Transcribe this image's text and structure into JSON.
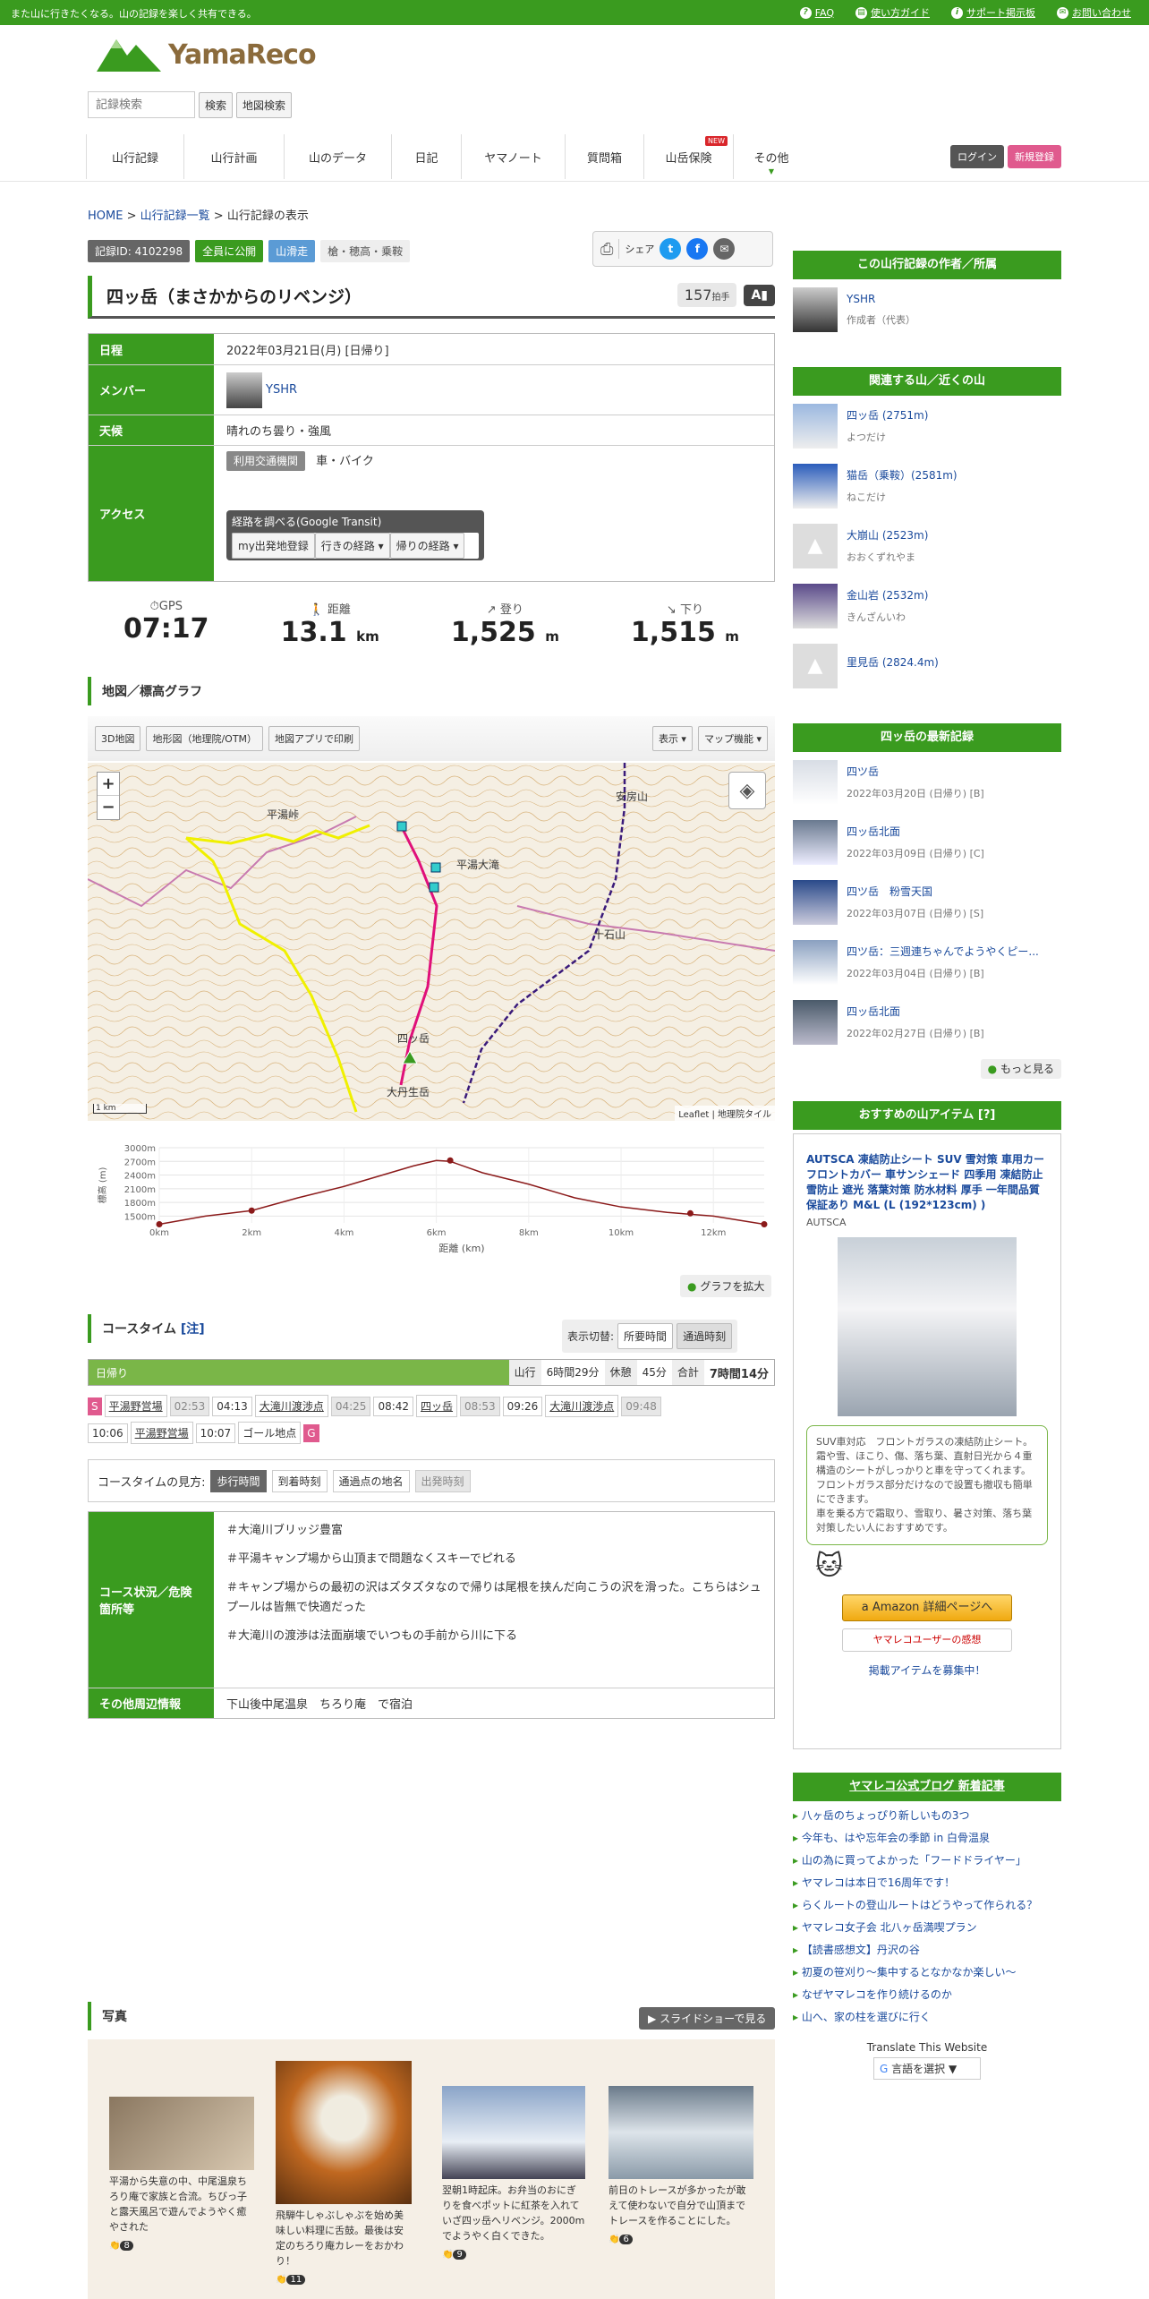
{
  "topbar": {
    "tagline": "また山に行きたくなる。山の記録を楽しく共有できる。",
    "links": [
      "FAQ",
      "使い方ガイド",
      "サポート掲示板",
      "お問い合わせ"
    ]
  },
  "logo": {
    "text": "YamaReco"
  },
  "search": {
    "placeholder": "記録検索",
    "button": "検索",
    "map_button": "地図検索"
  },
  "nav": {
    "items": [
      "山行記録",
      "山行計画",
      "山のデータ",
      "日記",
      "ヤマノート",
      "質問箱",
      "山岳保険",
      "その他"
    ],
    "new_badge": "NEW",
    "login": "ログイン",
    "signup": "新規登録"
  },
  "breadcrumb": {
    "home": "HOME",
    "list": "山行記録一覧",
    "current": "山行記録の表示",
    "sep": ">"
  },
  "badges": [
    "記録ID: 4102298",
    "全員に公開",
    "山滑走",
    "槍・穂高・乗鞍"
  ],
  "share": {
    "label": "シェア"
  },
  "title": "四ッ岳（まさかからのリベンジ）",
  "handclap": {
    "count": "157",
    "unit": "拍手"
  },
  "info": {
    "date_label": "日程",
    "date": "2022年03月21日(月) [日帰り]",
    "member_label": "メンバー",
    "member": "YSHR",
    "weather_label": "天候",
    "weather": "晴れのち曇り・強風",
    "access_label": "アクセス",
    "access_tag": "利用交通機関",
    "access": "車・バイク",
    "route_title": "経路を調べる(Google Transit)",
    "route_btns": [
      "my出発地登録",
      "行きの経路 ▾",
      "帰りの経路 ▾"
    ]
  },
  "stats": [
    {
      "label": "GPS",
      "value": "07:17",
      "unit": ""
    },
    {
      "label": "距離",
      "value": "13.1",
      "unit": "km"
    },
    {
      "label": "登り",
      "value": "1,525",
      "unit": "m"
    },
    {
      "label": "下り",
      "value": "1,515",
      "unit": "m"
    }
  ],
  "map_section": {
    "title": "地図／標高グラフ",
    "buttons": [
      "3D地図",
      "地形図（地理院/OTM）",
      "地図アプリで印刷"
    ],
    "right": [
      "表示 ▾",
      "マップ機能 ▾"
    ],
    "labels": [
      "平湯峠",
      "平湯大滝",
      "安房山",
      "十石山",
      "四ッ岳",
      "大丹生岳"
    ],
    "attr": "Leaflet | 地理院タイル",
    "scale": "1 km"
  },
  "chart_data": {
    "type": "line",
    "ylabel": "標高 (m)",
    "xlabel": "距離 (km)",
    "yticks": [
      "3000m",
      "2700m",
      "2400m",
      "2100m",
      "1800m",
      "1500m"
    ],
    "xticks": [
      "0km",
      "2km",
      "4km",
      "6km",
      "8km",
      "10km",
      "12km"
    ],
    "ylim": [
      1350,
      3000
    ],
    "xlim": [
      0,
      13.1
    ],
    "x": [
      0,
      1,
      2,
      3,
      4,
      5,
      5.5,
      6,
      6.3,
      7,
      8,
      9,
      10,
      11,
      12,
      13.1
    ],
    "y": [
      1320,
      1500,
      1620,
      1900,
      2150,
      2450,
      2600,
      2720,
      2700,
      2450,
      2200,
      1900,
      1700,
      1580,
      1500,
      1320
    ],
    "markers": [
      [
        0,
        1320
      ],
      [
        2,
        1620
      ],
      [
        6.3,
        2720
      ],
      [
        11.5,
        1560
      ],
      [
        13.1,
        1320
      ]
    ]
  },
  "expand": "グラフを拡大",
  "coursetime": {
    "title": "コースタイム",
    "note": "[注]",
    "toggle_label": "表示切替:",
    "toggle": [
      "所要時間",
      "通過時刻"
    ],
    "day": "日帰り",
    "move_label": "山行",
    "move": "6時間29分",
    "rest_label": "休憩",
    "rest": "45分",
    "total_label": "合計",
    "total": "7時間14分",
    "row1": [
      "S",
      "平湯野営場",
      "02:53",
      "04:13",
      "大滝川渡渉点",
      "04:25",
      "08:42",
      "四ッ岳",
      "08:53",
      "09:26",
      "大滝川渡渉点",
      "09:48"
    ],
    "row2": [
      "10:06",
      "平湯野営場",
      "10:07",
      "ゴール地点",
      "G"
    ],
    "howto_label": "コースタイムの見方:",
    "howto": [
      "歩行時間",
      "到着時刻",
      "通過点の地名",
      "出発時刻"
    ]
  },
  "course": {
    "cond_label": "コース状況／危険箇所等",
    "lines": [
      "＃大滝川ブリッジ豊富",
      "＃平湯キャンプ場から山頂まで問題なくスキーでピれる",
      "＃キャンプ場からの最初の沢はズタズタなので帰りは尾根を挟んだ向こうの沢を滑った。こちらはシュプールは皆無で快適だった",
      "＃大滝川の渡渉は法面崩壊でいつもの手前から川に下る"
    ],
    "other_label": "その他周辺情報",
    "other": "下山後中尾温泉　ちろり庵　で宿泊"
  },
  "photos": {
    "title": "写真",
    "slideshow": "スライドショーで見る",
    "items": [
      {
        "caption": "平湯から失意の中、中尾温泉ちろり庵で家族と合流。ちびっ子と露天風呂で遊んでようやく癒やされた",
        "likes": "8"
      },
      {
        "caption": "飛騨牛しゃぶしゃぶを始め美味しい料理に舌鼓。最後は安定のちろり庵カレーをおかわり！",
        "likes": "11"
      },
      {
        "caption": "翌朝1時起床。お弁当のおにぎりを食べポットに紅茶を入れていざ四ッ岳へリベンジ。2000mでようやく白くできた。",
        "likes": "9"
      },
      {
        "caption": "前日のトレースが多かったが敢えて使わないで自分で山頂までトレースを作ることにした。",
        "likes": "6"
      }
    ]
  },
  "side": {
    "author_head": "この山行記録の作者／所属",
    "author": "YSHR",
    "author_role": "作成者（代表）",
    "mtn_head": "関連する山／近くの山",
    "mountains": [
      {
        "name": "四ッ岳 (2751m)",
        "kana": "よつだけ"
      },
      {
        "name": "猫岳（乗鞍）(2581m)",
        "kana": "ねこだけ"
      },
      {
        "name": "大崩山 (2523m)",
        "kana": "おおくずれやま"
      },
      {
        "name": "金山岩 (2532m)",
        "kana": "きんざんいわ"
      },
      {
        "name": "里見岳 (2824.4m)",
        "kana": ""
      }
    ],
    "latest_head": "四ッ岳の最新記録",
    "latest": [
      {
        "name": "四ツ岳",
        "date": "2022年03月20日 (日帰り) [B]"
      },
      {
        "name": "四ッ岳北面",
        "date": "2022年03月09日 (日帰り) [C]"
      },
      {
        "name": "四ツ岳　粉雪天国",
        "date": "2022年03月07日 (日帰り) [S]"
      },
      {
        "name": "四ツ岳：三週連ちゃんでようやくピー...",
        "date": "2022年03月04日 (日帰り) [B]"
      },
      {
        "name": "四ッ岳北面",
        "date": "2022年02月27日 (日帰り) [B]"
      }
    ],
    "more": "もっと見る",
    "item_head": "おすすめの山アイテム [?]",
    "item_title": "AUTSCA 凍結防止シート SUV 雪対策 車用カーフロントカバー 車サンシェード 四季用 凍結防止 雪防止 遮光 落葉対策 防水材料 厚手 一年間品質保証あり M&L (L (192*123cm) )",
    "item_brand": "AUTSCA",
    "item_desc": "SUV車対応　フロントガラスの凍結防止シート。\n霜や雪、ほこり、傷、落ち葉、直射日光から４重構造のシートがしっかりと車を守ってくれます。フロントガラス部分だけなので設置も撤収も簡単にできます。\n車を乗る方で霜取り、雪取り、暑さ対策、落ち葉対策したい人におすすめです。",
    "amazon_btn": "Amazon 詳細ページへ",
    "review_btn": "ヤマレコユーザーの感想",
    "recruit": "掲載アイテムを募集中！",
    "blog_head": "ヤマレコ公式ブログ 新着記事",
    "blogs": [
      "八ヶ岳のちょっぴり新しいもの3つ",
      "今年も、はや忘年会の季節 in 白骨温泉",
      "山の為に買ってよかった「フードドライヤー」",
      "ヤマレコは本日で16周年です！",
      "らくルートの登山ルートはどうやって作られる？",
      "ヤマレコ女子会 北八ヶ岳満喫プラン",
      "【読書感想文】丹沢の谷",
      "初夏の笹刈り～集中するとなかなか楽しい～",
      "なぜヤマレコを作り続けるのか",
      "山へ、家の柱を選びに行く"
    ],
    "translate": "Translate This Website",
    "translate_btn": "言語を選択 ▼"
  },
  "colors": {
    "brand": "#3a9b1f",
    "route_magenta": "#e0107a",
    "route_yellow": "#f0f000"
  }
}
